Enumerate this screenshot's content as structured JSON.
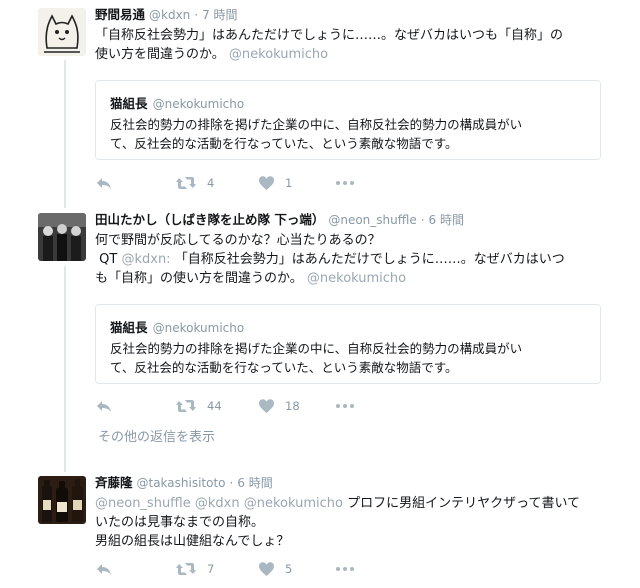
{
  "tweets": [
    {
      "name": "野間易通",
      "handle": "@kdxn",
      "time": "7 時間",
      "text_lines": [
        "「自称反社会勢力」はあんただけでしょうに……。なぜバカはいつも「自称」の",
        "使い方を間違うのか。"
      ],
      "mention": "@nekokumicho",
      "quote": {
        "name": "猫組長",
        "handle": "@nekokumicho",
        "text_lines": [
          "反社会的勢力の排除を掲げた企業の中に、自称反社会的勢力の構成員がい",
          "て、反社会的な活動を行なっていた、という素敵な物語です。"
        ]
      },
      "retweets": "4",
      "likes": "1"
    },
    {
      "name": "田山たかし（しばき隊を止め隊 下っ端）",
      "handle": "@neon_shuffle",
      "time": "6 時間",
      "text_line1": "何で野間が反応してるのかな？心当たりあるの？",
      "qt_prefix": "QT",
      "qt_handle": "@kdxn:",
      "qt_text1": "「自称反社会勢力」はあんただけでしょうに……。なぜバカはいつ",
      "qt_text2": "も「自称」の使い方を間違うのか。",
      "mention": "@nekokumicho",
      "quote": {
        "name": "猫組長",
        "handle": "@nekokumicho",
        "text_lines": [
          "反社会的勢力の排除を掲げた企業の中に、自称反社会的勢力の構成員がい",
          "て、反社会的な活動を行なっていた、という素敵な物語です。"
        ]
      },
      "retweets": "44",
      "likes": "18"
    },
    {
      "name": "斉藤隆",
      "handle": "@takashisitoto",
      "time": "6 時間",
      "mentions": "@neon_shuffle @kdxn @nekokumicho",
      "text_after_mentions": " プロフに男組インテリヤクザって書いて",
      "text_lines": [
        "いたのは見事なまでの自称。",
        "男組の組長は山健組なんでしょ？"
      ],
      "retweets": "7",
      "likes": "5"
    }
  ],
  "more_replies": "その他の返信を表示",
  "icons": {
    "reply": "reply-icon",
    "retweet": "retweet-icon",
    "like": "heart-icon",
    "more": "more-icon"
  },
  "colors": {
    "icon_gray": "#aab8c2",
    "secondary_text": "#8899a6",
    "border": "#e1e8ed"
  }
}
